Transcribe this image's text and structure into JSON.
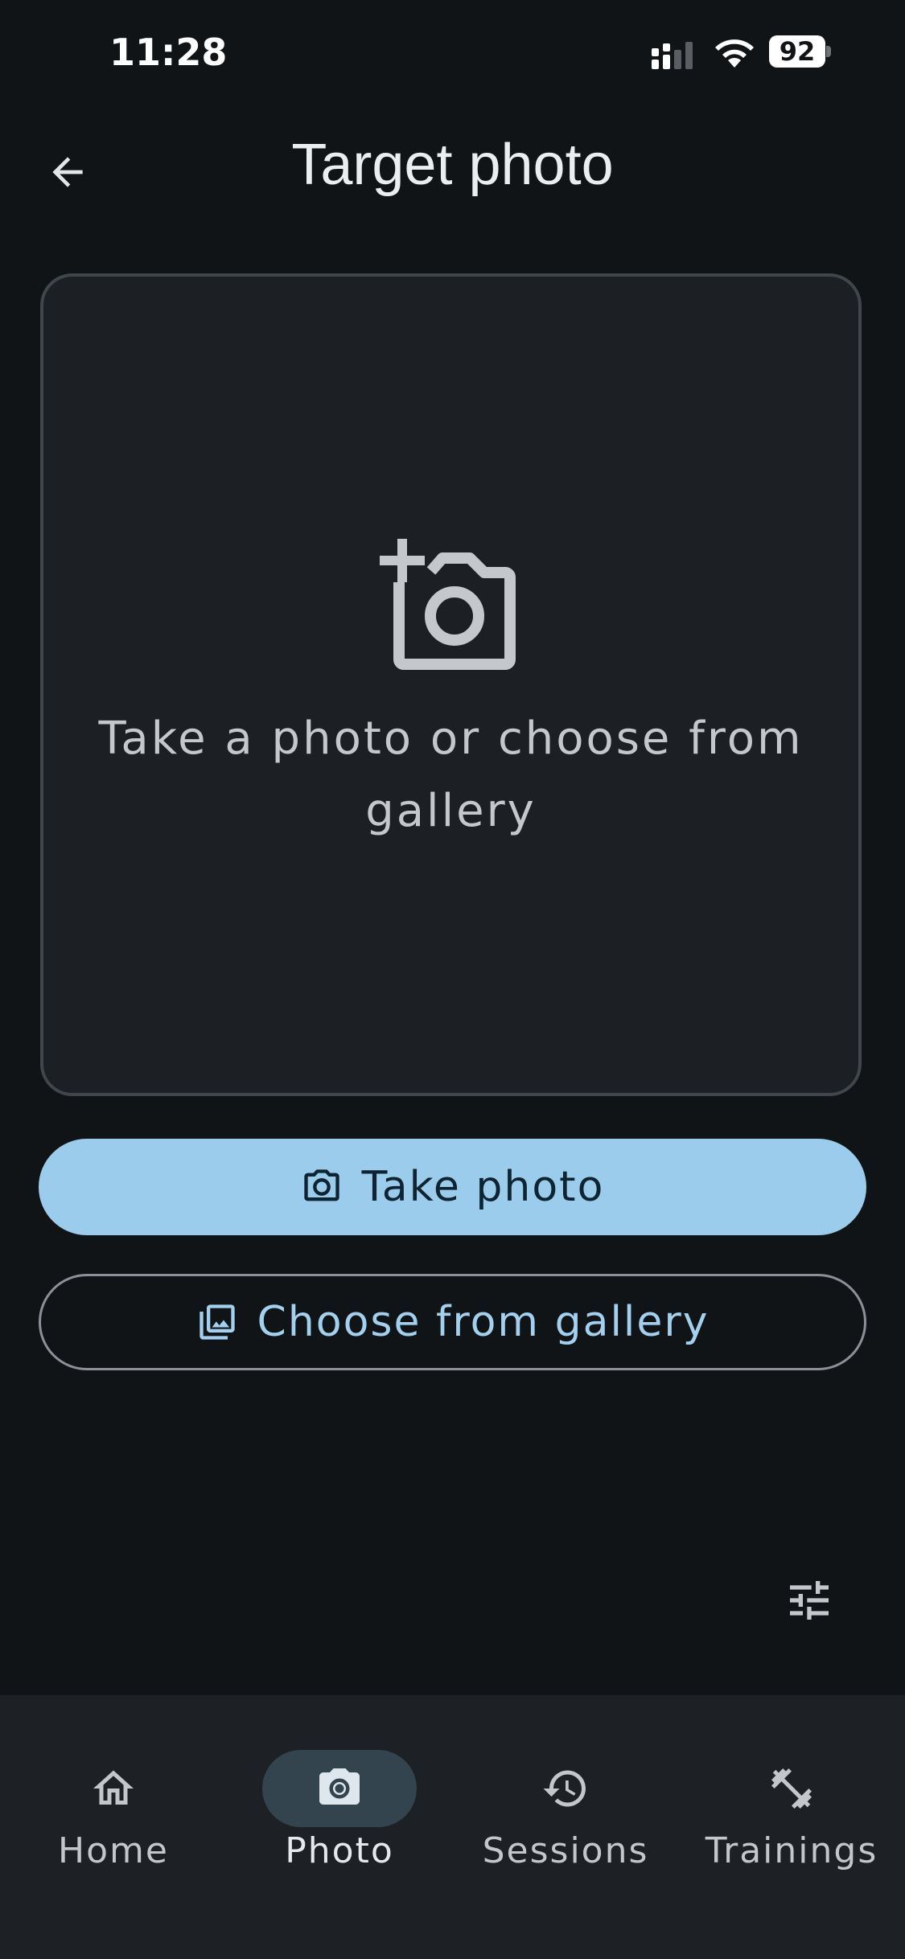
{
  "status_bar": {
    "time": "11:28",
    "battery": "92",
    "icons": [
      "cellular-signal-icon",
      "wifi-icon",
      "battery-icon"
    ]
  },
  "app_bar": {
    "back_icon": "arrow-left-icon",
    "title": "Target photo"
  },
  "preview": {
    "icon": "add-a-photo-icon",
    "placeholder_text": "Take a photo or choose from gallery"
  },
  "actions": {
    "take_photo": {
      "label": "Take photo",
      "icon": "camera-icon"
    },
    "choose_gallery": {
      "label": "Choose from gallery",
      "icon": "photo-library-icon"
    }
  },
  "tune_button": {
    "icon": "tune-icon"
  },
  "bottom_nav": {
    "items": [
      {
        "label": "Home",
        "icon": "home-icon",
        "active": false
      },
      {
        "label": "Photo",
        "icon": "camera-icon",
        "active": true
      },
      {
        "label": "Sessions",
        "icon": "history-icon",
        "active": false
      },
      {
        "label": "Trainings",
        "icon": "fitness-icon",
        "active": false
      }
    ]
  },
  "colors": {
    "background": "#111417",
    "card": "#1c1f23",
    "primary": "#9ccceb",
    "nav_background": "#1d2024",
    "nav_indicator": "#34444f"
  }
}
